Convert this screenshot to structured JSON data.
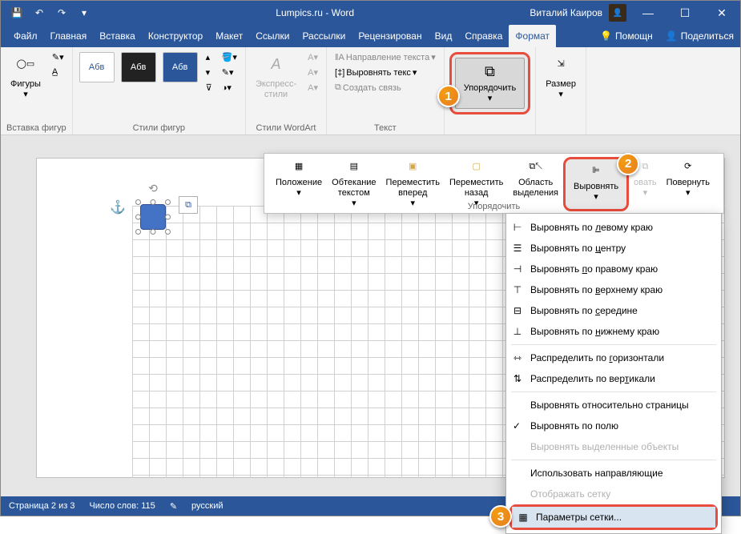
{
  "title": "Lumpics.ru  -  Word",
  "user": "Виталий Каиров",
  "qat": {
    "save": "💾",
    "undo": "↶",
    "redo": "↷",
    "customize": "▾"
  },
  "window": {
    "min": "—",
    "max": "☐",
    "close": "✕"
  },
  "tabs": {
    "file": "Файл",
    "home": "Главная",
    "insert": "Вставка",
    "design": "Конструктор",
    "layout": "Макет",
    "references": "Ссылки",
    "mailings": "Рассылки",
    "review": "Рецензирован",
    "view": "Вид",
    "help": "Справка",
    "format": "Формат"
  },
  "help": {
    "tell": "Помощн",
    "share": "Поделиться"
  },
  "ribbon": {
    "shapes": {
      "btn": "Фигуры",
      "group": "Вставка фигур"
    },
    "styles": {
      "group": "Стили фигур",
      "sample": "Абв"
    },
    "wordart": {
      "btn": "Экспресс-\nстили",
      "group": "Стили WordArt"
    },
    "text": {
      "dir": "Направление текста",
      "align": "Выровнять текс",
      "link": "Создать связь",
      "group": "Текст"
    },
    "arrange": {
      "btn": "Упорядочить"
    },
    "size": {
      "btn": "Размер"
    }
  },
  "arrangePanel": {
    "position": "Положение",
    "wrap": "Обтекание\nтекстом",
    "forward": "Переместить\nвперед",
    "backward": "Переместить\nназад",
    "selection": "Область\nвыделения",
    "align": "Выровнять",
    "group": "овать",
    "rotate": "Повернуть",
    "label": "Упорядочить"
  },
  "alignMenu": {
    "left": "Выровнять по левому краю",
    "center": "Выровнять по центру",
    "right": "Выровнять по правому краю",
    "top": "Выровнять по верхнему краю",
    "middle": "Выровнять по середине",
    "bottom": "Выровнять по нижнему краю",
    "distH": "Распределить по горизонтали",
    "distV": "Распределить по вертикали",
    "relPage": "Выровнять относительно страницы",
    "relMargin": "Выровнять по полю",
    "relSel": "Выровнять выделенные объекты",
    "guides": "Использовать направляющие",
    "showGrid": "Отображать сетку",
    "gridParams": "Параметры сетки..."
  },
  "status": {
    "page": "Страница 2 из 3",
    "words": "Число слов: 115",
    "lang": "русский"
  },
  "badges": {
    "b1": "1",
    "b2": "2",
    "b3": "3"
  }
}
